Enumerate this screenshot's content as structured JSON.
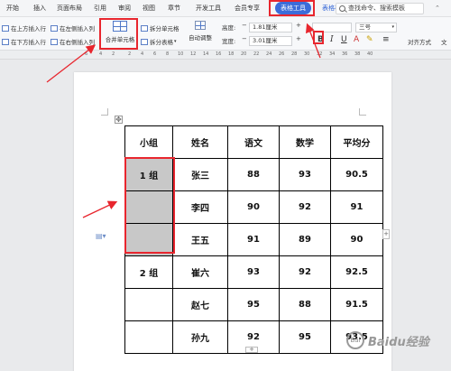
{
  "menu": {
    "items": [
      "开始",
      "插入",
      "页面布局",
      "引用",
      "审阅",
      "视图",
      "章节",
      "开发工具",
      "会员专享"
    ],
    "active_tab": "表格工具",
    "style_tab": "表格样式",
    "search_placeholder": "查找命令、搜索模板"
  },
  "ribbon": {
    "insert_above": "在上方插入行",
    "insert_below": "在下方插入行",
    "insert_left": "在左侧插入列",
    "insert_right": "在右侧插入列",
    "merge_cells": "合并单元格",
    "split_cells": "拆分单元格",
    "split_table": "拆分表格",
    "auto_adjust": "自动调整",
    "height_label": "高度:",
    "height_value": "1.81厘米",
    "width_label": "宽度:",
    "width_value": "3.01厘米",
    "font_size": "三号",
    "align_label": "对齐方式",
    "text_dir_label": "文"
  },
  "ruler": {
    "numbers": [
      "6",
      "4",
      "2",
      "2",
      "4",
      "6",
      "8",
      "10",
      "12",
      "14",
      "16",
      "18",
      "20",
      "22",
      "24",
      "26",
      "28",
      "30",
      "32",
      "34",
      "36",
      "38",
      "40"
    ]
  },
  "table": {
    "headers": [
      "小组",
      "姓名",
      "语文",
      "数学",
      "平均分"
    ],
    "rows": [
      [
        "1 组",
        "张三",
        "88",
        "93",
        "90.5"
      ],
      [
        "",
        "李四",
        "90",
        "92",
        "91"
      ],
      [
        "",
        "王五",
        "91",
        "89",
        "90"
      ],
      [
        "2 组",
        "崔六",
        "93",
        "92",
        "92.5"
      ],
      [
        "",
        "赵七",
        "95",
        "88",
        "91.5"
      ],
      [
        "",
        "孙九",
        "92",
        "95",
        "93.5"
      ]
    ]
  },
  "watermark": {
    "text": "Baidu经验"
  }
}
